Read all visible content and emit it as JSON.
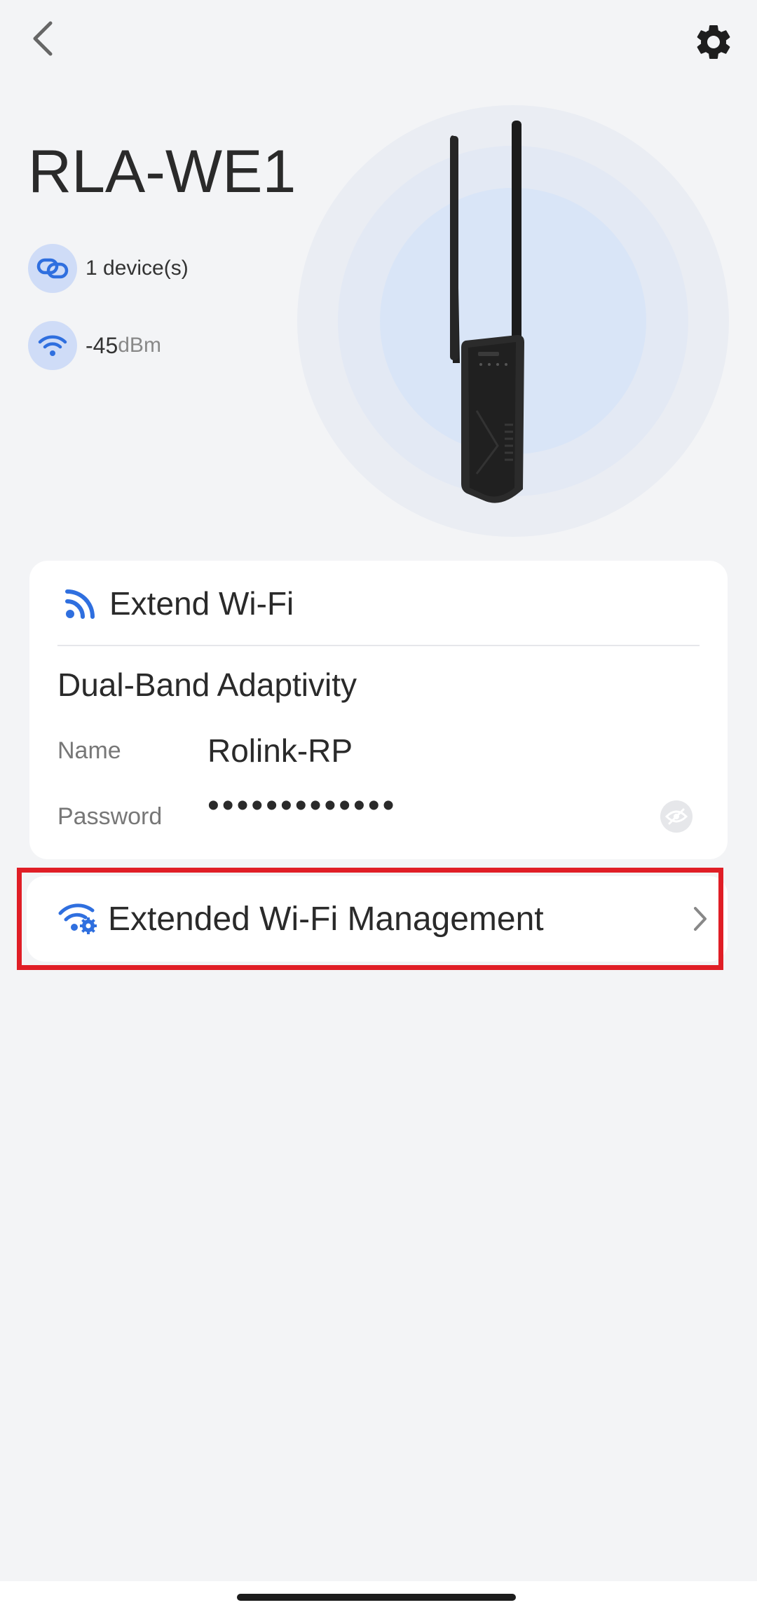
{
  "device": {
    "title": "RLA-WE1",
    "devices_text": "1 device(s)",
    "signal_value": "-45",
    "signal_unit": "dBm"
  },
  "extend_card": {
    "title": "Extend Wi-Fi",
    "band": "Dual-Band Adaptivity",
    "name_label": "Name",
    "name_value": "Rolink-RP",
    "password_label": "Password",
    "password_value": "•••••••••••••"
  },
  "manage_card": {
    "title": "Extended Wi-Fi Management"
  },
  "colors": {
    "accent": "#2f6fdf",
    "highlight": "#e01e26",
    "badge_bg": "#cfdcf7"
  },
  "icons": {
    "back": "chevron-left-icon",
    "settings": "gear-icon",
    "devices": "link-icon",
    "signal": "wifi-icon",
    "extend": "rss-icon",
    "manage": "wifi-gear-icon",
    "eye": "eye-off-icon",
    "chevron": "chevron-right-icon"
  }
}
